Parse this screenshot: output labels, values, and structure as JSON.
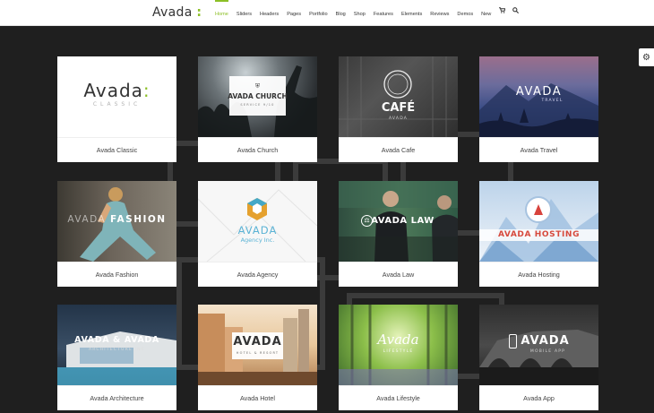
{
  "header": {
    "logo_text": "Avada",
    "logo_accent": ":",
    "nav": [
      {
        "label": "Home",
        "active": true
      },
      {
        "label": "Sliders"
      },
      {
        "label": "Headers"
      },
      {
        "label": "Pages"
      },
      {
        "label": "Portfolio"
      },
      {
        "label": "Blog"
      },
      {
        "label": "Shop"
      },
      {
        "label": "Features"
      },
      {
        "label": "Elements"
      },
      {
        "label": "Reviews"
      },
      {
        "label": "Demos"
      },
      {
        "label": "New"
      }
    ],
    "icons": [
      "cart-icon",
      "search-icon"
    ]
  },
  "settings_icon": "gear-icon",
  "accent_color": "#8cbf26",
  "demos": [
    {
      "title": "Avada Classic",
      "thumb_text": "Avada",
      "thumb_accent": ":",
      "thumb_sub": "CLASSIC"
    },
    {
      "title": "Avada Church",
      "thumb_text": "AVADA CHURCH",
      "thumb_sub": "SERVICE 9/10"
    },
    {
      "title": "Avada Cafe",
      "thumb_text": "CAFÉ",
      "thumb_sub": "AVADA"
    },
    {
      "title": "Avada Travel",
      "thumb_text": "AVADA",
      "thumb_sub": "TRAVEL"
    },
    {
      "title": "Avada Fashion",
      "thumb_text": "AVADA",
      "thumb_accent": "FASHION"
    },
    {
      "title": "Avada Agency",
      "thumb_text": "AVADA",
      "thumb_sub": "Agency Inc."
    },
    {
      "title": "Avada Law",
      "thumb_text": "AVADA LAW"
    },
    {
      "title": "Avada Hosting",
      "thumb_text": "AVADA HOSTING"
    },
    {
      "title": "Avada Architecture",
      "thumb_text": "AVADA & AVADA",
      "thumb_sub": "ARCHITECTURE INC"
    },
    {
      "title": "Avada Hotel",
      "thumb_text": "AVADA",
      "thumb_sub": "HOTEL & RESORT"
    },
    {
      "title": "Avada Lifestyle",
      "thumb_text": "Avada",
      "thumb_sub": "LIFESTYLE"
    },
    {
      "title": "Avada App",
      "thumb_text": "AVADA",
      "thumb_sub": "MOBILE APP"
    }
  ]
}
